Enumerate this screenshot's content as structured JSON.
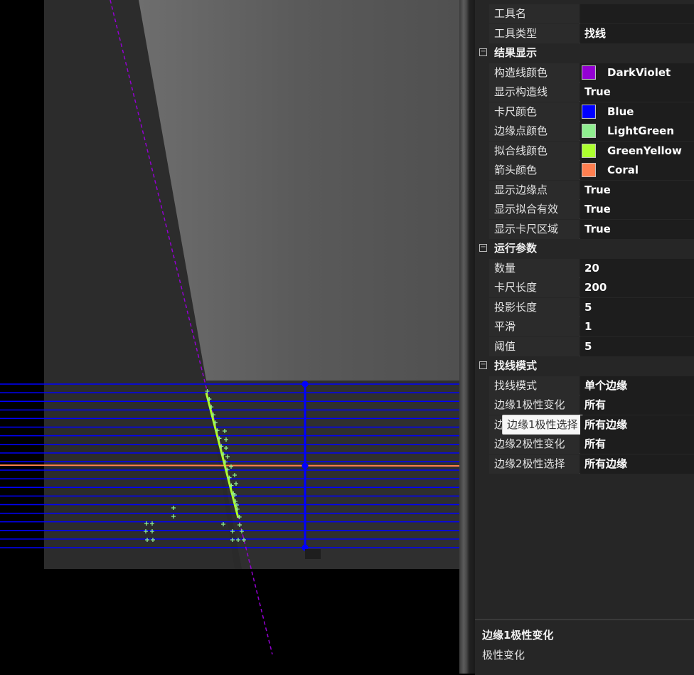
{
  "property_grid": {
    "general": [
      {
        "name": "工具名",
        "value": ""
      },
      {
        "name": "工具类型",
        "value": "找线"
      }
    ],
    "categories": [
      {
        "toggle": "⊟",
        "title": "结果显示",
        "rows": [
          {
            "name": "构造线颜色",
            "value": "DarkViolet",
            "swatch": "#9400d3"
          },
          {
            "name": "显示构造线",
            "value": "True"
          },
          {
            "name": "卡尺颜色",
            "value": "Blue",
            "swatch": "#0000ff"
          },
          {
            "name": "边缘点颜色",
            "value": "LightGreen",
            "swatch": "#90ee90"
          },
          {
            "name": "拟合线颜色",
            "value": "GreenYellow",
            "swatch": "#adff2f"
          },
          {
            "name": "箭头颜色",
            "value": "Coral",
            "swatch": "#ff7f50"
          },
          {
            "name": "显示边缘点",
            "value": "True"
          },
          {
            "name": "显示拟合有效",
            "value": "True"
          },
          {
            "name": "显示卡尺区域",
            "value": "True"
          }
        ]
      },
      {
        "toggle": "⊟",
        "title": "运行参数",
        "rows": [
          {
            "name": "数量",
            "value": "20"
          },
          {
            "name": "卡尺长度",
            "value": "200"
          },
          {
            "name": "投影长度",
            "value": "5"
          },
          {
            "name": "平滑",
            "value": "1"
          },
          {
            "name": "阈值",
            "value": "5"
          }
        ]
      },
      {
        "toggle": "⊟",
        "title": "找线模式",
        "rows": [
          {
            "name": "找线模式",
            "value": "单个边缘"
          },
          {
            "name": "边缘1极性变化",
            "value": "所有"
          },
          {
            "name": "边缘1极性选择",
            "value": "所有边缘",
            "tooltip": "边缘1极性选择"
          },
          {
            "name": "边缘2极性变化",
            "value": "所有"
          },
          {
            "name": "边缘2极性选择",
            "value": "所有边缘"
          }
        ]
      }
    ],
    "description": {
      "title": "边缘1极性变化",
      "text": "极性变化"
    }
  },
  "viewer": {
    "construct_line_color": "#9400d3",
    "caliper_color": "#0000ff",
    "edge_point_color": "#90ee90",
    "fit_line_color": "#adff2f",
    "arrow_color": "#ff7f50",
    "caliper_count": 20
  }
}
